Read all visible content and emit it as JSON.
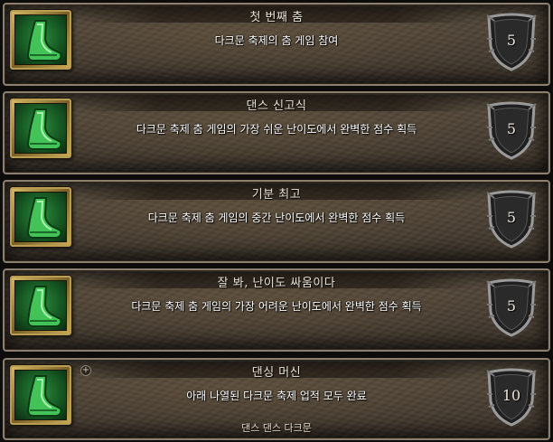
{
  "achievements": [
    {
      "title": "첫 번째 춤",
      "description": "다크문 축제의 춤 게임 참여",
      "points": "5",
      "icon": "green-boot-icon"
    },
    {
      "title": "댄스 신고식",
      "description": "다크문 축제 춤 게임의 가장 쉬운 난이도에서 완벽한 점수 획득",
      "points": "5",
      "icon": "green-boot-icon"
    },
    {
      "title": "기분 최고",
      "description": "다크문 축제 춤 게임의 중간 난이도에서 완벽한 점수 획득",
      "points": "5",
      "icon": "green-boot-icon"
    },
    {
      "title": "잘 봐, 난이도 싸움이다",
      "description": "다크문 축제 춤 게임의 가장 어려운 난이도에서 완벽한 점수 획득",
      "points": "5",
      "icon": "green-boot-icon"
    },
    {
      "title": "댄싱 머신",
      "description": "아래 나열된 다크문 축제 업적 모두 완료",
      "points": "10",
      "icon": "green-boot-icon",
      "expand": "+",
      "criteria": "댄스 댄스 다크문"
    }
  ],
  "colors": {
    "icon_bg": "#175a24",
    "frame_gold": "#b89d52",
    "panel": "#4a4034",
    "border": "#8a7f70"
  }
}
